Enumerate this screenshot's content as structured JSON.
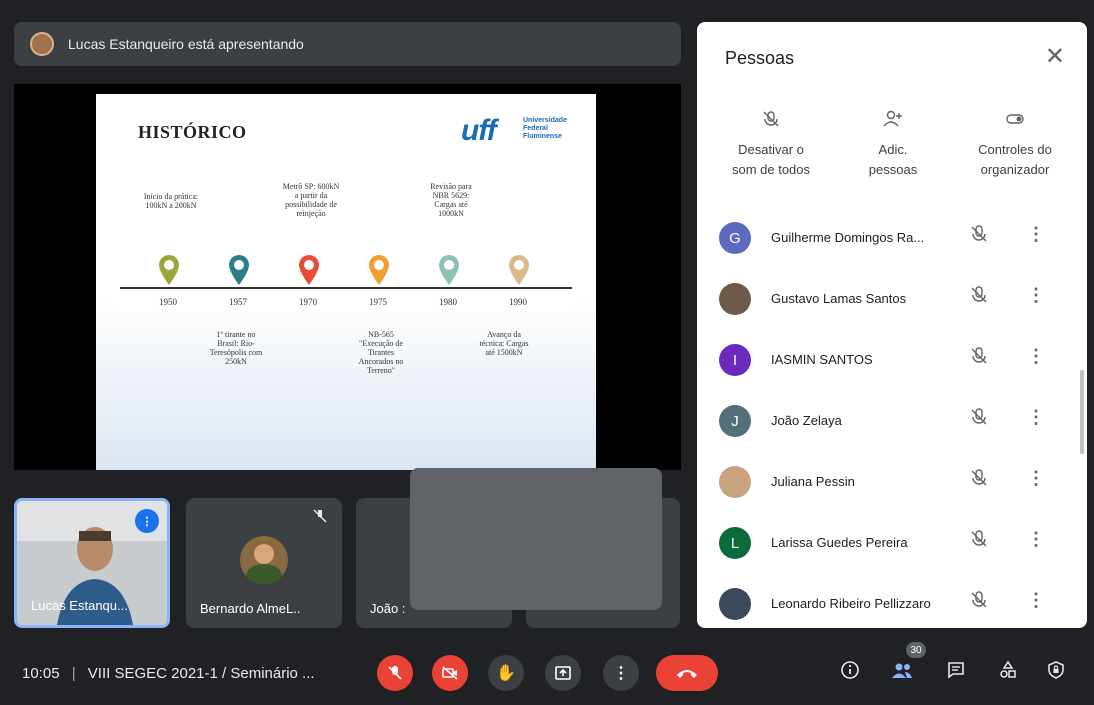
{
  "presenter_bar": {
    "text": "Lucas Estanqueiro está apresentando"
  },
  "slide": {
    "title": "HISTÓRICO",
    "logo": {
      "word": "uff",
      "line1": "Universidade",
      "line2": "Federal",
      "line3": "Fluminense"
    },
    "notes_top": [
      "Início da prática:\n100kN a 200kN",
      "Metrô SP: 600kN\na partir da\npossibilidade de\nreinjeção",
      "Revisão para\nNBR 5629:\nCargas até\n1000kN"
    ],
    "years": [
      "1950",
      "1957",
      "1970",
      "1975",
      "1980",
      "1990"
    ],
    "pin_colors": [
      "#9aa63a",
      "#2a7f8a",
      "#e84c35",
      "#f0a030",
      "#8fc0b8",
      "#d9b98a"
    ],
    "notes_bottom": [
      "1º tirante no\nBrasil: Rio-\nTeresópolis com\n250kN",
      "NB-565\n\"Execução de\nTirantes\nAncorados no\nTerreno\"",
      "Avanço da\ntécnica: Cargas\naté 1500kN"
    ]
  },
  "tiles": [
    {
      "name": "Lucas Estanqu..."
    },
    {
      "name": "Bernardo AlmeL.."
    },
    {
      "name": "João :"
    }
  ],
  "panel": {
    "title": "Pessoas",
    "actions": [
      {
        "label1": "Desativar o",
        "label2": "som de todos",
        "icon": "mic-off-icon"
      },
      {
        "label1": "Adic.",
        "label2": "pessoas",
        "icon": "add-person-icon"
      },
      {
        "label1": "Controles do",
        "label2": "organizador",
        "icon": "toggle-icon"
      }
    ],
    "people": [
      {
        "initial": "G",
        "name": "Guilherme Domingos Ra...",
        "color": "#5c6bc0"
      },
      {
        "initial": "",
        "name": "Gustavo Lamas Santos",
        "color": "#6d5a4a"
      },
      {
        "initial": "I",
        "name": "IASMIN SANTOS",
        "color": "#6a2bbd"
      },
      {
        "initial": "J",
        "name": "João Zelaya",
        "color": "#546e7a"
      },
      {
        "initial": "",
        "name": "Juliana Pessin",
        "color": "#c9a27e"
      },
      {
        "initial": "L",
        "name": "Larissa Guedes Pereira",
        "color": "#0b6b3a"
      },
      {
        "initial": "",
        "name": "Leonardo Ribeiro Pellizzaro",
        "color": "#3b4a5a"
      }
    ]
  },
  "bottom_bar": {
    "time": "10:05",
    "meeting": "VIII SEGEC 2021-1 / Seminário ...",
    "participant_count": "30"
  }
}
